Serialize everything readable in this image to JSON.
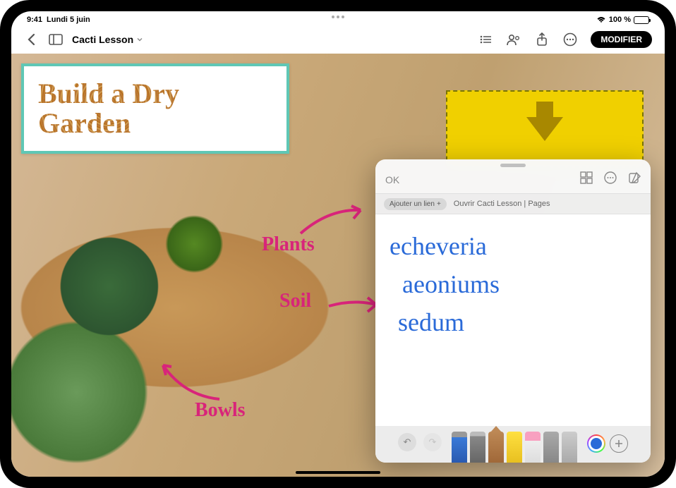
{
  "status": {
    "time": "9:41",
    "date": "Lundi 5 juin",
    "battery": "100 %"
  },
  "toolbar": {
    "doc_title": "Cacti Lesson",
    "edit_button": "MODIFIER"
  },
  "slide": {
    "title": "Build a Dry Garden",
    "annotations": {
      "plants": "Plants",
      "soil": "Soil",
      "bowls": "Bowls"
    }
  },
  "quicknote": {
    "ok": "OK",
    "add_link": "Ajouter un lien",
    "open_link": "Ouvrir Cacti Lesson | Pages",
    "lines": [
      "echeveria",
      "aeoniums",
      "sedum"
    ]
  }
}
